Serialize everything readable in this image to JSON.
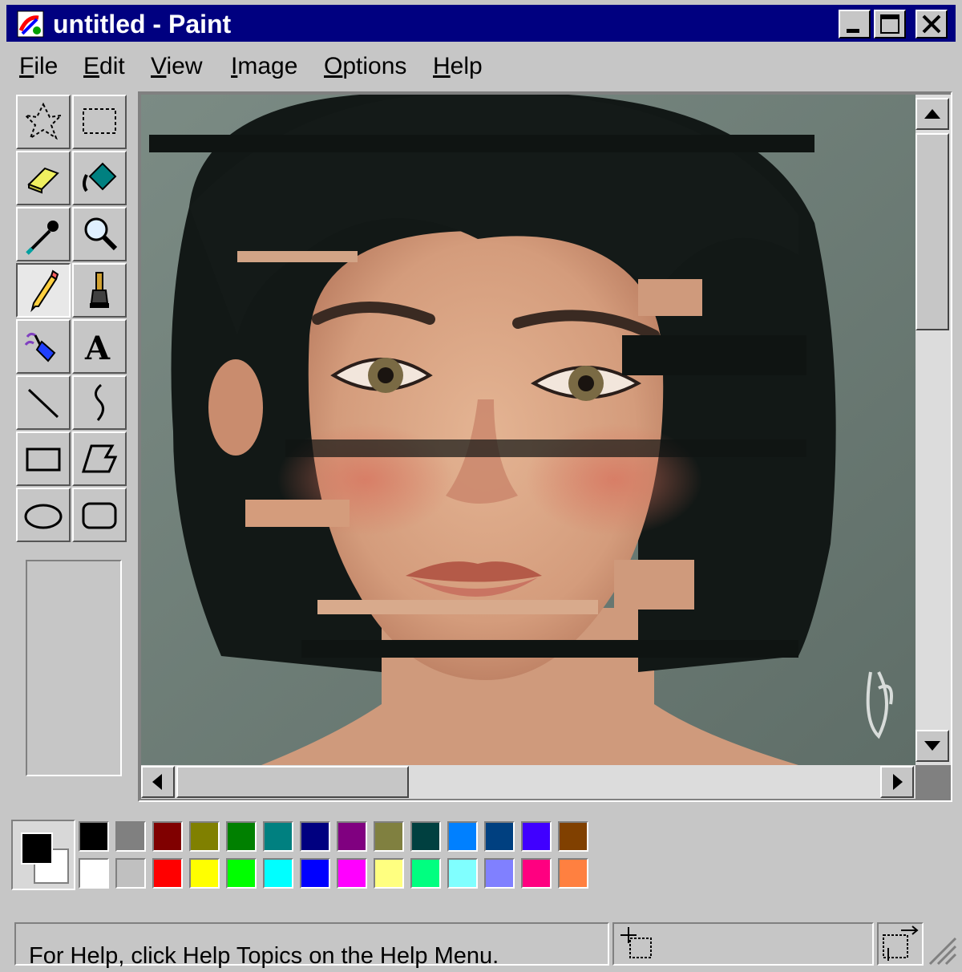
{
  "window": {
    "title": "untitled - Paint",
    "colors": {
      "titlebar": "#000080",
      "face": "#c6c6c6"
    }
  },
  "menu": {
    "items": [
      {
        "key": "F",
        "rest": "ile"
      },
      {
        "key": "E",
        "rest": "dit"
      },
      {
        "key": "V",
        "rest": "iew"
      },
      {
        "key": "I",
        "rest": "mage"
      },
      {
        "key": "O",
        "rest": "ptions"
      },
      {
        "key": "H",
        "rest": "elp"
      }
    ]
  },
  "tools": {
    "icons": [
      "free-form-select-icon",
      "select-icon",
      "eraser-icon",
      "fill-with-color-icon",
      "pick-color-icon",
      "magnifier-icon",
      "pencil-icon",
      "brush-icon",
      "airbrush-icon",
      "text-icon",
      "line-icon",
      "curve-icon",
      "rectangle-icon",
      "polygon-icon",
      "ellipse-icon",
      "rounded-rectangle-icon"
    ],
    "selected": "pencil-icon",
    "text_tool_glyph": "A"
  },
  "palette": {
    "foreground": "#000000",
    "background": "#ffffff",
    "top_row": [
      "#000000",
      "#808080",
      "#800000",
      "#808000",
      "#008000",
      "#008080",
      "#000080",
      "#800080",
      "#808040",
      "#004040",
      "#0080ff",
      "#004080",
      "#4000ff",
      "#804000"
    ],
    "bottom_row": [
      "#ffffff",
      "#c0c0c0",
      "#ff0000",
      "#ffff00",
      "#00ff00",
      "#00ffff",
      "#0000ff",
      "#ff00ff",
      "#ffff80",
      "#00ff80",
      "#80ffff",
      "#8080ff",
      "#ff0080",
      "#ff8040"
    ]
  },
  "status": {
    "help_text": "For Help, click Help Topics on the Help Menu."
  },
  "scrollbars": {
    "vertical_thumb_fraction": 0.33,
    "horizontal_thumb_fraction": 0.33
  }
}
